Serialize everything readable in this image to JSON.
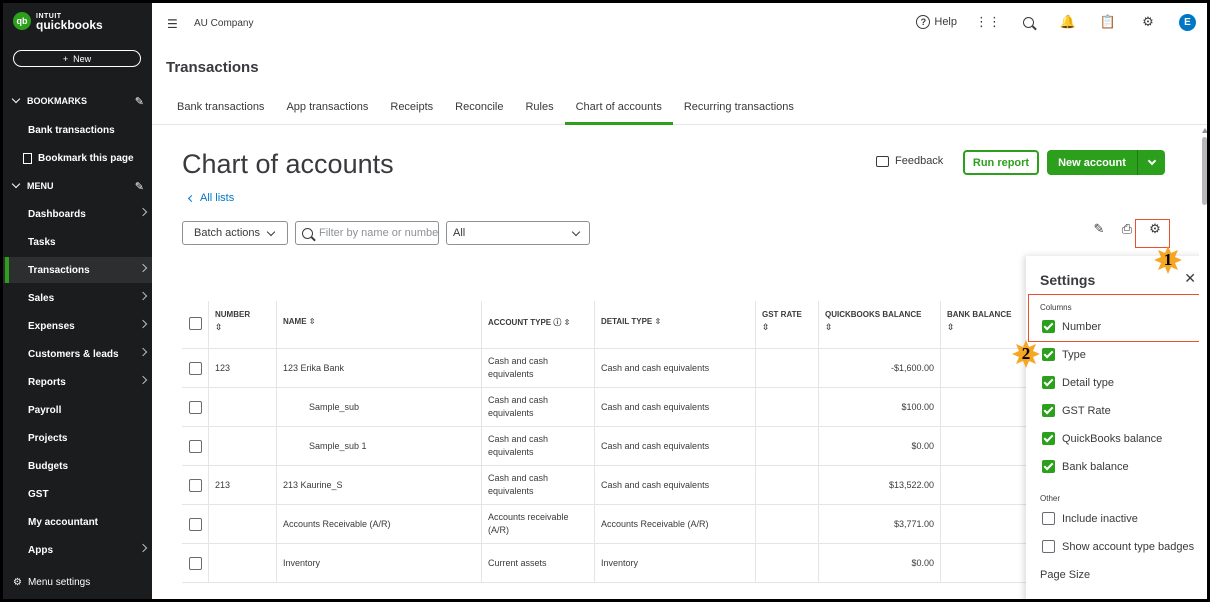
{
  "app": {
    "logo_small": "INTUIT",
    "logo_name": "quickbooks",
    "logo_badge": "qb",
    "new_label": "New",
    "company": "AU Company",
    "help_label": "Help",
    "avatar_initial": "E",
    "page_title": "Transactions"
  },
  "sidebar": {
    "bookmarks_header": "BOOKMARKS",
    "bookmarks": [
      "Bank transactions"
    ],
    "bookmark_this_page": "Bookmark this page",
    "menu_header": "MENU",
    "items": [
      {
        "label": "Dashboards",
        "chevron": true
      },
      {
        "label": "Tasks",
        "chevron": false
      },
      {
        "label": "Transactions",
        "chevron": true,
        "active": true
      },
      {
        "label": "Sales",
        "chevron": true
      },
      {
        "label": "Expenses",
        "chevron": true
      },
      {
        "label": "Customers & leads",
        "chevron": true
      },
      {
        "label": "Reports",
        "chevron": true
      },
      {
        "label": "Payroll",
        "chevron": false
      },
      {
        "label": "Projects",
        "chevron": false
      },
      {
        "label": "Budgets",
        "chevron": false
      },
      {
        "label": "GST",
        "chevron": false
      },
      {
        "label": "My accountant",
        "chevron": false
      },
      {
        "label": "Apps",
        "chevron": true
      }
    ],
    "menu_settings": "Menu settings"
  },
  "tabs": [
    {
      "label": "Bank transactions"
    },
    {
      "label": "App transactions"
    },
    {
      "label": "Receipts"
    },
    {
      "label": "Reconcile"
    },
    {
      "label": "Rules"
    },
    {
      "label": "Chart of accounts",
      "active": true
    },
    {
      "label": "Recurring transactions"
    }
  ],
  "main": {
    "heading": "Chart of accounts",
    "all_lists": "All lists",
    "feedback": "Feedback",
    "run_report": "Run report",
    "new_account": "New account",
    "batch_actions": "Batch actions",
    "filter_placeholder": "Filter by name or number",
    "type_filter": "All"
  },
  "table": {
    "headers": {
      "number": "NUMBER",
      "name": "NAME",
      "account_type": "ACCOUNT TYPE",
      "detail_type": "DETAIL TYPE",
      "gst_rate": "GST RATE",
      "qb_balance": "QUICKBOOKS BALANCE",
      "bank_balance": "BANK BALANCE"
    },
    "rows": [
      {
        "number": "123",
        "name": "123 Erika Bank",
        "type": "Cash and cash equivalents",
        "detail": "Cash and cash equivalents",
        "gst": "",
        "balance": "-$1,600.00",
        "indent": false
      },
      {
        "number": "",
        "name": "Sample_sub",
        "type": "Cash and cash equivalents",
        "detail": "Cash and cash equivalents",
        "gst": "",
        "balance": "$100.00",
        "indent": true
      },
      {
        "number": "",
        "name": "Sample_sub 1",
        "type": "Cash and cash equivalents",
        "detail": "Cash and cash equivalents",
        "gst": "",
        "balance": "$0.00",
        "indent": true
      },
      {
        "number": "213",
        "name": "213 Kaurine_S",
        "type": "Cash and cash equivalents",
        "detail": "Cash and cash equivalents",
        "gst": "",
        "balance": "$13,522.00",
        "indent": false
      },
      {
        "number": "",
        "name": "Accounts Receivable (A/R)",
        "type": "Accounts receivable (A/R)",
        "detail": "Accounts Receivable (A/R)",
        "gst": "",
        "balance": "$3,771.00",
        "indent": false
      },
      {
        "number": "",
        "name": "Inventory",
        "type": "Current assets",
        "detail": "Inventory",
        "gst": "",
        "balance": "$0.00",
        "indent": false
      }
    ]
  },
  "settings": {
    "title": "Settings",
    "columns_label": "Columns",
    "columns": [
      {
        "label": "Number",
        "checked": true
      },
      {
        "label": "Type",
        "checked": true
      },
      {
        "label": "Detail type",
        "checked": true
      },
      {
        "label": "GST Rate",
        "checked": true
      },
      {
        "label": "QuickBooks balance",
        "checked": true
      },
      {
        "label": "Bank balance",
        "checked": true
      }
    ],
    "other_label": "Other",
    "other": [
      {
        "label": "Include inactive",
        "checked": false
      },
      {
        "label": "Show account type badges",
        "checked": false
      }
    ],
    "page_size": "Page Size"
  },
  "annotations": {
    "badge_1": "1",
    "badge_2": "2"
  },
  "colors": {
    "brand_green": "#2ca01c",
    "sidebar_bg": "#1b1c1e",
    "link_blue": "#0077c5",
    "highlight_red": "#e8502f",
    "badge_orange": "#f5a623"
  }
}
